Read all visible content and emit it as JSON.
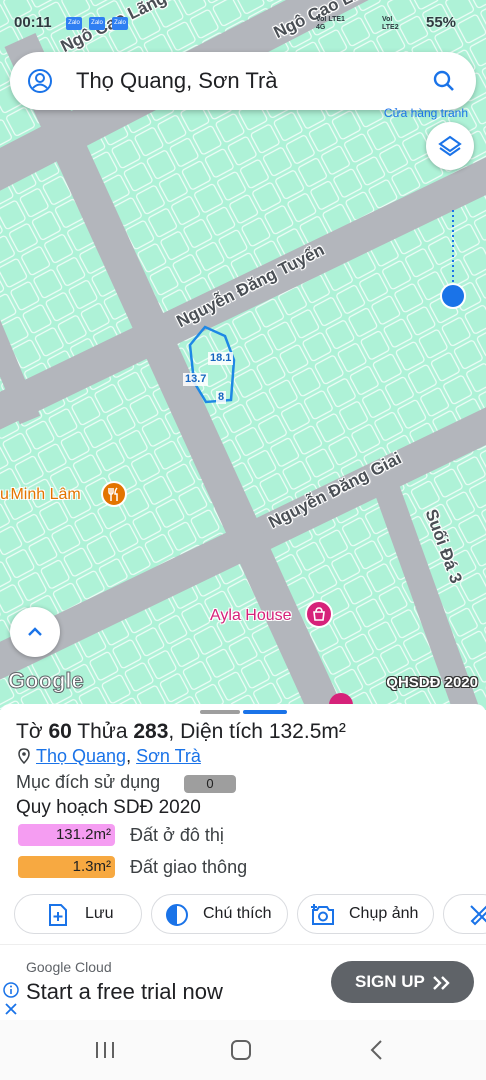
{
  "status_bar": {
    "time": "00:11",
    "apps": [
      "Zalo",
      "Zalo",
      "Zalo"
    ],
    "network_1": "VoI LTE1 4G",
    "network_2": "VoI LTE2",
    "battery": "55%"
  },
  "search": {
    "query": "Thọ Quang, Sơn Trà",
    "partial_poi": "Cửa hàng tranh"
  },
  "map": {
    "roads": [
      "Ngô Cao Lãng",
      "Ngô Cao Lãng",
      "Nguyễn Đăng Tuyển",
      "Nguyễn Đăng Giai",
      "Suối Đá 3"
    ],
    "pois": [
      {
        "name": "Minh Lâm",
        "icon": "restaurant-icon",
        "color": "#e37400"
      },
      {
        "name": "Ayla House",
        "icon": "shopping-icon",
        "color": "#d6227a"
      }
    ],
    "parcel_dims": [
      "18.1",
      "13.7",
      "8"
    ],
    "attribution": "Google",
    "layer_label": "QHSDĐ 2020",
    "colors": {
      "land": "#aef2d7",
      "road": "#b3b6bc",
      "parcel_outline": "#1e88e5",
      "location": "#1a73e8"
    }
  },
  "sheet": {
    "to_label": "Tờ",
    "to_value": "60",
    "thua_label": "Thửa",
    "thua_value": "283",
    "area_label": "Diện tích",
    "area_value": "132.5m²",
    "ward": "Thọ Quang",
    "district": "Sơn Trà",
    "purpose_label": "Mục đích sử dụng",
    "purpose_value": "0",
    "plan_title": "Quy hoạch SDĐ 2020",
    "legend": [
      {
        "area": "131.2m²",
        "label": "Đất ở đô thị",
        "color": "#f59df2"
      },
      {
        "area": "1.3m²",
        "label": "Đất giao thông",
        "color": "#f7a941"
      }
    ],
    "actions": {
      "save": "Lưu",
      "legend": "Chú thích",
      "capture": "Chụp ảnh"
    }
  },
  "ad": {
    "brand": "Google Cloud",
    "title": "Start a free trial now",
    "cta": "SIGN UP"
  }
}
